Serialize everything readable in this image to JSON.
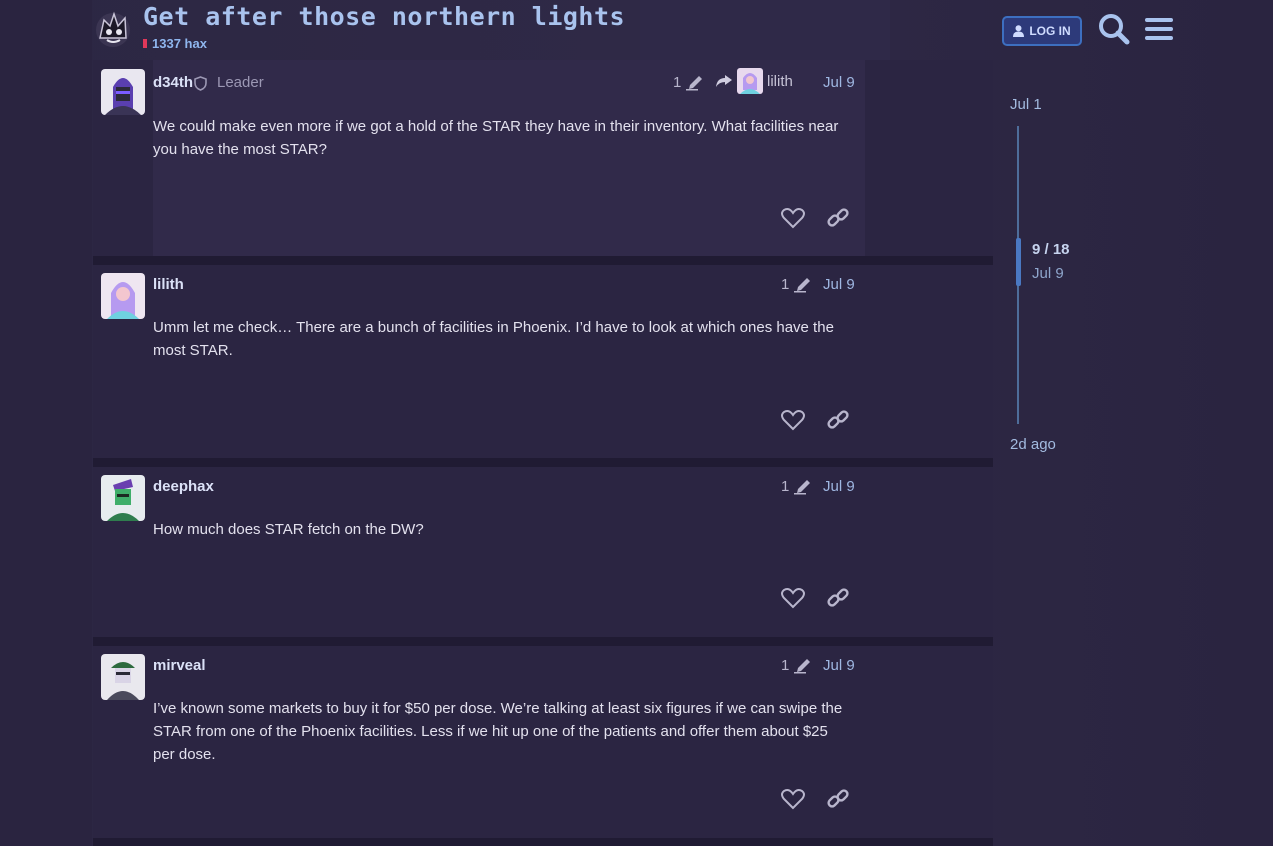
{
  "topic": {
    "title": "Get after those northern lights",
    "category": "1337 hax"
  },
  "header": {
    "login_label": "LOG IN"
  },
  "posts": [
    {
      "username": "d34th",
      "role": "Leader",
      "edit_count": "1",
      "reply_to": "lilith",
      "date": "Jul 9",
      "body": "We could make even more if we got a hold of the STAR they have in their inventory. What facilities near you have the most STAR?"
    },
    {
      "username": "lilith",
      "edit_count": "1",
      "date": "Jul 9",
      "body": "Umm let me check… There are a bunch of facilities in Phoenix. I’d have to look at which ones have the most STAR."
    },
    {
      "username": "deephax",
      "edit_count": "1",
      "date": "Jul 9",
      "body": "How much does STAR fetch on the DW?"
    },
    {
      "username": "mirveal",
      "edit_count": "1",
      "date": "Jul 9",
      "body": "I’ve known some markets to buy it for $50 per dose. We’re talking at least six figures if we can swipe the STAR from one of the Phoenix facilities. Less if we hit up one of the patients and offer them about $25 per dose."
    }
  ],
  "timeline": {
    "start": "Jul 1",
    "position": "9 / 18",
    "position_date": "Jul 9",
    "end": "2d ago"
  },
  "colors": {
    "accent_blue": "#3d6fc0",
    "category_red": "#e0385a",
    "background": "#2a2440"
  },
  "icons": {
    "like": "heart-icon",
    "share": "link-icon",
    "edit": "pencil-icon",
    "reply": "reply-arrow-icon",
    "search": "search-icon",
    "menu": "hamburger-menu-icon",
    "user": "user-icon",
    "moderator": "shield-icon"
  }
}
